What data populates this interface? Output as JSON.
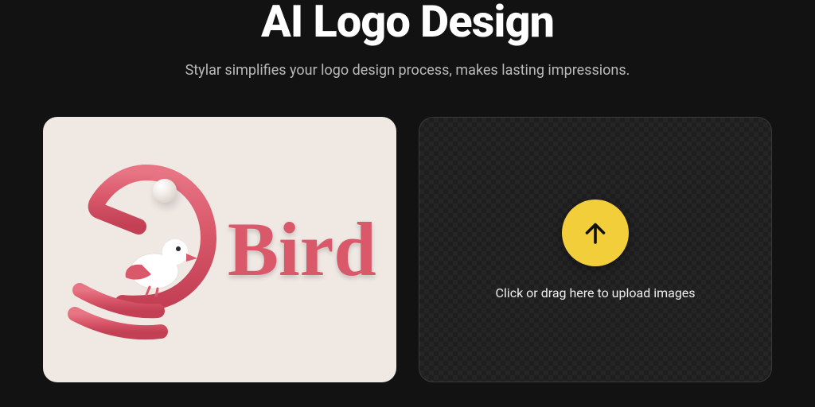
{
  "header": {
    "title": "AI Logo Design",
    "subtitle": "Stylar simplifies your logo design process, makes lasting impressions."
  },
  "example": {
    "logo_text": "Bird"
  },
  "upload": {
    "instruction": "Click or drag here to upload images"
  },
  "colors": {
    "accent_yellow": "#f2cf3a",
    "logo_red": "#d9586a",
    "card_bg": "#efe8e3",
    "page_bg": "#121212"
  },
  "icons": {
    "upload": "arrow-up-icon"
  }
}
